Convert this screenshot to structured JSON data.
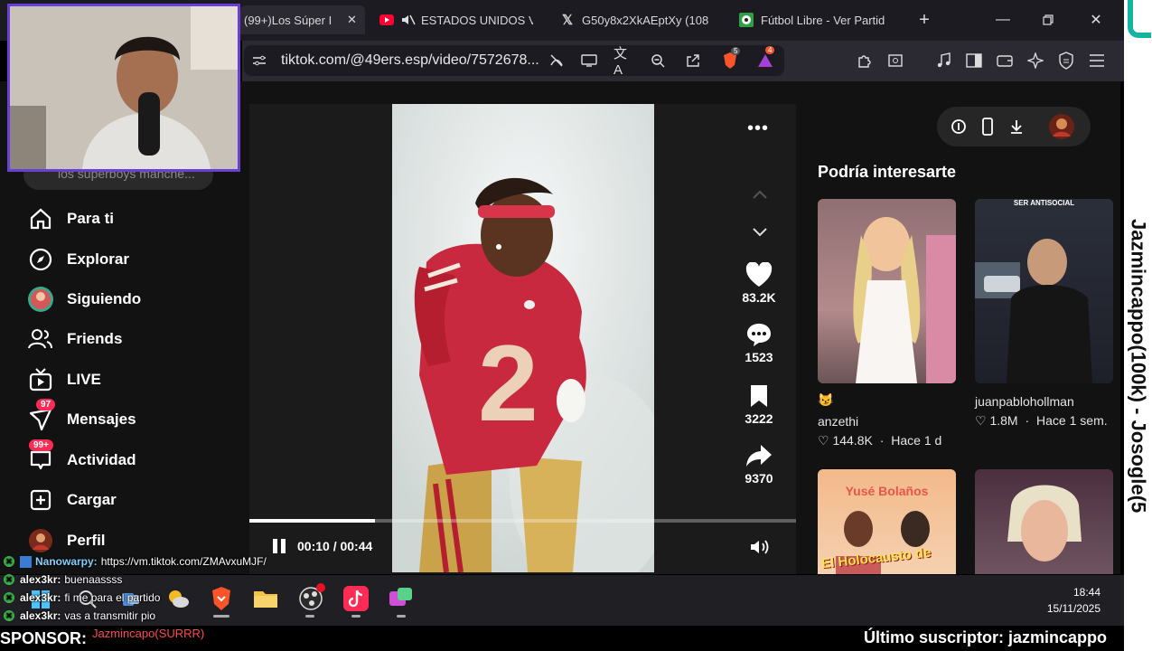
{
  "browser": {
    "tabs": [
      {
        "label": "(99+)Los Súper I",
        "close": "✕",
        "favicon": "tiktok",
        "active": true
      },
      {
        "label": "ESTADOS UNIDOS V",
        "favicon": "youtube-muted"
      },
      {
        "label": "G50y8x2XkAEptXy (108",
        "favicon": "x"
      },
      {
        "label": "Fútbol Libre - Ver Partid",
        "favicon": "ball"
      }
    ],
    "new_tab": "+",
    "url": "tiktok.com/@49ers.esp/video/7572678...",
    "brave_badge": "5",
    "rewards_badge": "4"
  },
  "sidebar": {
    "search_placeholder": "los superboys manche...",
    "items": [
      {
        "label": "Para ti",
        "icon": "home-icon"
      },
      {
        "label": "Explorar",
        "icon": "compass-icon"
      },
      {
        "label": "Siguiendo",
        "icon": "avatar-icon"
      },
      {
        "label": "Friends",
        "icon": "friends-icon"
      },
      {
        "label": "LIVE",
        "icon": "live-icon"
      },
      {
        "label": "Mensajes",
        "icon": "message-icon",
        "badge": "97"
      },
      {
        "label": "Actividad",
        "icon": "activity-icon",
        "badge": "99+"
      },
      {
        "label": "Cargar",
        "icon": "upload-icon"
      },
      {
        "label": "Perfil",
        "icon": "profile-icon"
      }
    ]
  },
  "player": {
    "time": "00:10 / 00:44",
    "progress": 0.23,
    "actions": [
      {
        "icon": "heart-icon",
        "count": "83.2K"
      },
      {
        "icon": "comment-icon",
        "count": "1523"
      },
      {
        "icon": "bookmark-icon",
        "count": "3222"
      },
      {
        "icon": "share-icon",
        "count": "9370"
      }
    ]
  },
  "recommendations": {
    "title": "Podría interesarte",
    "items": [
      {
        "emoji": "😼",
        "user": "anzethi",
        "likes": "144.8K",
        "age": "Hace 1 d"
      },
      {
        "overlay": "SER ANTISOCIAL",
        "user": "juanpablohollman",
        "likes": "1.8M",
        "age": "Hace 1 sem."
      },
      {
        "overlay": "Yusé Bolaños",
        "caption": "El Holocausto de"
      },
      {}
    ]
  },
  "stream_overlay": {
    "vertical_text": "Jazmincappo(100k) - Josogle(5",
    "chat": [
      {
        "user": "Nanowarpy:",
        "msg": "https://vm.tiktok.com/ZMAvxuMJF/"
      },
      {
        "user": "alex3kr:",
        "msg": "buenaassss"
      },
      {
        "user": "alex3kr:",
        "msg": "fi me para el partido"
      },
      {
        "user": "alex3kr:",
        "msg": "vas a transmitir pio"
      }
    ],
    "sponsor_label": "SPONSOR:",
    "sponsor_name": "Jazmincapo(SURRR)",
    "subscriber": "Último suscriptor: jazmincappo"
  },
  "taskbar": {
    "time": "18:44",
    "date": "15/11/2025"
  },
  "colors": {
    "tiktok_red": "#fe2c55",
    "jersey": "#c8293e",
    "overlay_border": "#6a3fd6",
    "chat_green": "#3cb44b"
  }
}
